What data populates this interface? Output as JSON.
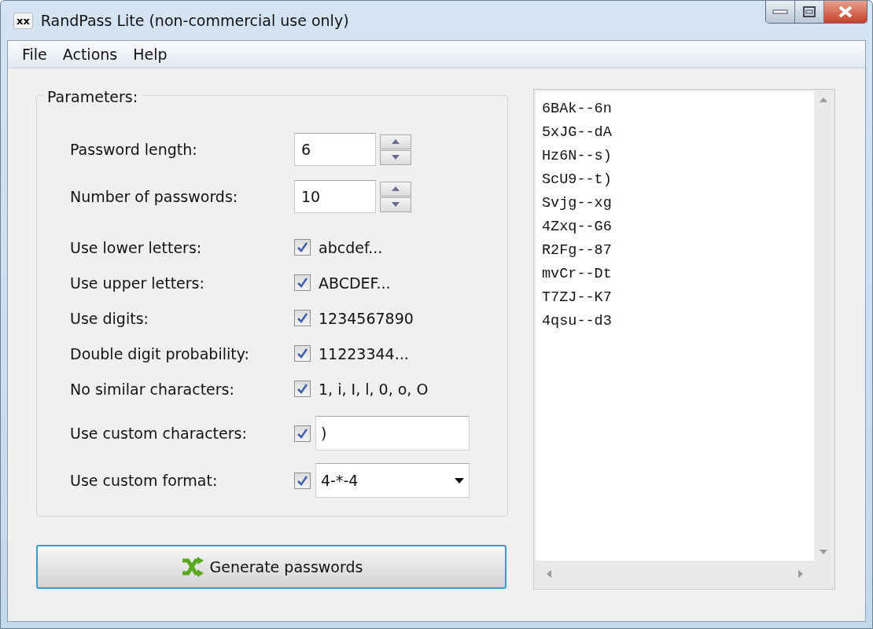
{
  "window": {
    "icon_text": "xx",
    "title": "RandPass Lite (non-commercial use only)"
  },
  "menu": [
    "File",
    "Actions",
    "Help"
  ],
  "parameters": {
    "title": "Parameters:",
    "rows": [
      {
        "kind": "spinner",
        "label": "Password length:",
        "value": "6"
      },
      {
        "kind": "spinner",
        "label": "Number of passwords:",
        "value": "10"
      },
      {
        "kind": "checkbox",
        "label": "Use lower letters:",
        "checked": true,
        "text": "abcdef..."
      },
      {
        "kind": "checkbox",
        "label": "Use upper letters:",
        "checked": true,
        "text": "ABCDEF..."
      },
      {
        "kind": "checkbox",
        "label": "Use digits:",
        "checked": true,
        "text": "1234567890"
      },
      {
        "kind": "checkbox",
        "label": "Double digit probability:",
        "checked": true,
        "text": "11223344..."
      },
      {
        "kind": "checkbox",
        "label": "No similar characters:",
        "checked": true,
        "text": "1, i, I, l, 0, o, O"
      },
      {
        "kind": "input",
        "label": "Use custom characters:",
        "checked": true,
        "value": ")"
      },
      {
        "kind": "dropdown",
        "label": "Use custom format:",
        "checked": true,
        "value": "4-*-4"
      }
    ]
  },
  "generate_button": "Generate passwords",
  "passwords": [
    "6BAk--6n",
    "5xJG--dA",
    "Hz6N--s)",
    "ScU9--t)",
    "Svjg--xg",
    "4Zxq--G6",
    "R2Fg--87",
    "mvCr--Dt",
    "T7ZJ--K7",
    "4qsu--d3"
  ]
}
